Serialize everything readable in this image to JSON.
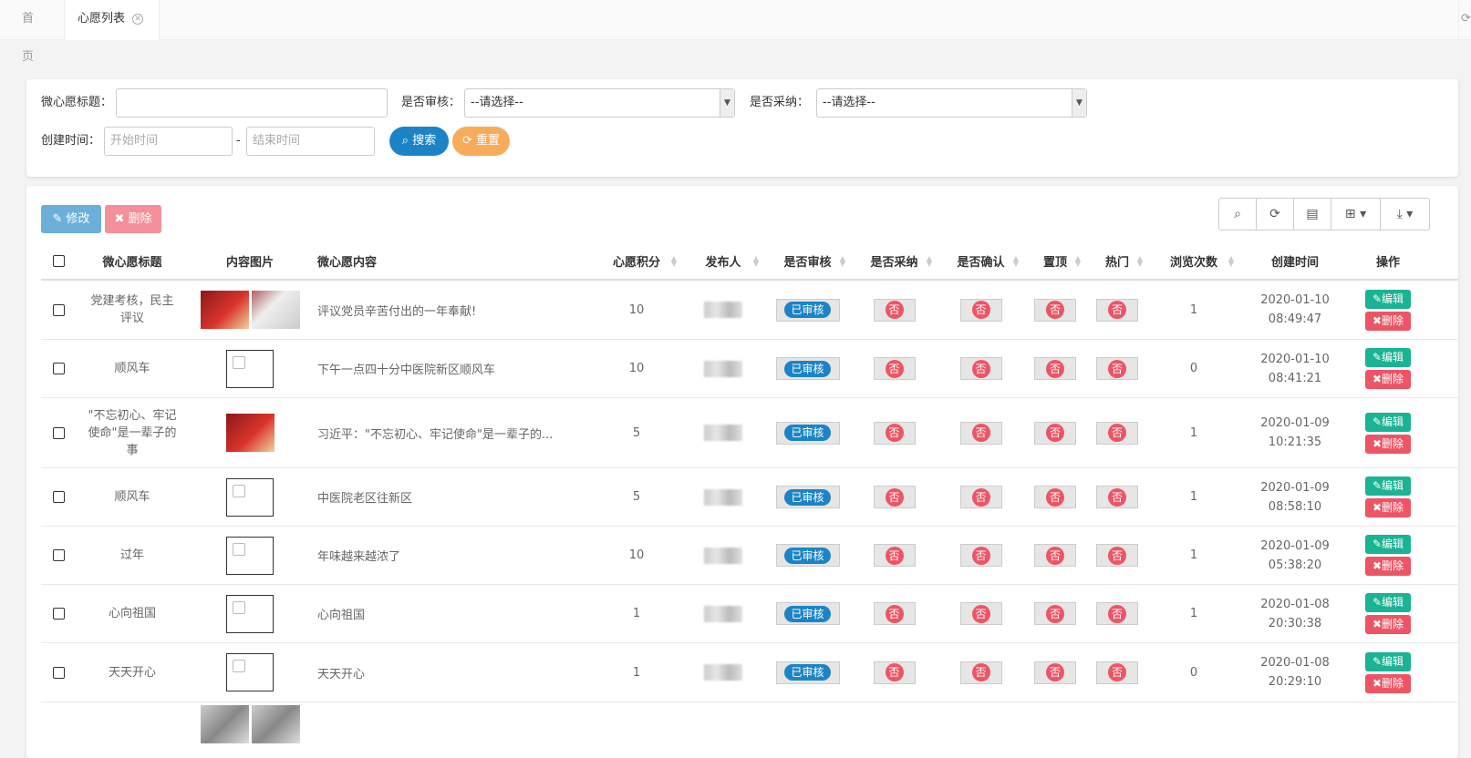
{
  "tabs": {
    "home": "首页",
    "current": "心愿列表"
  },
  "search": {
    "title_label": "微心愿标题：",
    "audit_label": "是否审核：",
    "audit_value": "--请选择--",
    "adopt_label": "是否采纳：",
    "adopt_value": "--请选择--",
    "time_label": "创建时间：",
    "start_placeholder": "开始时间",
    "end_placeholder": "结束时间",
    "dash": "-",
    "search_button": "搜索",
    "reset_button": "重置"
  },
  "table_buttons": {
    "edit": "修改",
    "delete": "删除"
  },
  "columns": [
    "微心愿标题",
    "内容图片",
    "微心愿内容",
    "心愿积分",
    "发布人",
    "是否审核",
    "是否采纳",
    "是否确认",
    "置顶",
    "热门",
    "浏览次数",
    "创建时间",
    "操作"
  ],
  "rows": [
    {
      "title": "党建考核，民主评议",
      "content": "评议党员辛苦付出的一年奉献!",
      "points": "10",
      "audit": "已审核",
      "adopt": "否",
      "confirm": "否",
      "top": "否",
      "hot": "否",
      "views": "1",
      "date": "2020-01-10",
      "time": "08:49:47",
      "images": "photo-pair"
    },
    {
      "title": "顺风车",
      "content": "下午一点四十分中医院新区顺风车",
      "points": "10",
      "audit": "已审核",
      "adopt": "否",
      "confirm": "否",
      "top": "否",
      "hot": "否",
      "views": "0",
      "date": "2020-01-10",
      "time": "08:41:21",
      "images": "broken"
    },
    {
      "title": "\"不忘初心、牢记使命\"是一辈子的事",
      "content": "习近平：\"不忘初心、牢记使命\"是一辈子的...",
      "points": "5",
      "audit": "已审核",
      "adopt": "否",
      "confirm": "否",
      "top": "否",
      "hot": "否",
      "views": "1",
      "date": "2020-01-09",
      "time": "10:21:35",
      "images": "photo-red"
    },
    {
      "title": "顺风车",
      "content": "中医院老区往新区",
      "points": "5",
      "audit": "已审核",
      "adopt": "否",
      "confirm": "否",
      "top": "否",
      "hot": "否",
      "views": "1",
      "date": "2020-01-09",
      "time": "08:58:10",
      "images": "broken"
    },
    {
      "title": "过年",
      "content": "年味越来越浓了",
      "points": "10",
      "audit": "已审核",
      "adopt": "否",
      "confirm": "否",
      "top": "否",
      "hot": "否",
      "views": "1",
      "date": "2020-01-09",
      "time": "05:38:20",
      "images": "broken"
    },
    {
      "title": "心向祖国",
      "content": "心向祖国",
      "points": "1",
      "audit": "已审核",
      "adopt": "否",
      "confirm": "否",
      "top": "否",
      "hot": "否",
      "views": "1",
      "date": "2020-01-08",
      "time": "20:30:38",
      "images": "broken"
    },
    {
      "title": "天天开心",
      "content": "天天开心",
      "points": "1",
      "audit": "已审核",
      "adopt": "否",
      "confirm": "否",
      "top": "否",
      "hot": "否",
      "views": "0",
      "date": "2020-01-08",
      "time": "20:29:10",
      "images": "broken"
    }
  ],
  "row_actions": {
    "edit": "编辑",
    "delete": "删除"
  }
}
